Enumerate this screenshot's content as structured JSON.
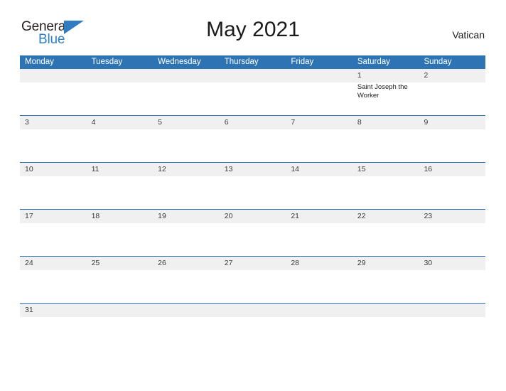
{
  "brand": {
    "name_part1": "General",
    "name_part2": "Blue",
    "triangle_color": "#2f7dc0",
    "text_color": "#231f20"
  },
  "header": {
    "title": "May 2021",
    "region": "Vatican"
  },
  "theme": {
    "header_blue": "#2e74b5",
    "date_band_gray": "#f0f0f0",
    "body_white": "#ffffff",
    "text_dark": "#3b3b3b"
  },
  "calendar": {
    "weekday_headers": [
      "Monday",
      "Tuesday",
      "Wednesday",
      "Thursday",
      "Friday",
      "Saturday",
      "Sunday"
    ],
    "weeks": [
      {
        "days": [
          {
            "num": "",
            "event": ""
          },
          {
            "num": "",
            "event": ""
          },
          {
            "num": "",
            "event": ""
          },
          {
            "num": "",
            "event": ""
          },
          {
            "num": "",
            "event": ""
          },
          {
            "num": "1",
            "event": "Saint Joseph the Worker"
          },
          {
            "num": "2",
            "event": ""
          }
        ]
      },
      {
        "days": [
          {
            "num": "3",
            "event": ""
          },
          {
            "num": "4",
            "event": ""
          },
          {
            "num": "5",
            "event": ""
          },
          {
            "num": "6",
            "event": ""
          },
          {
            "num": "7",
            "event": ""
          },
          {
            "num": "8",
            "event": ""
          },
          {
            "num": "9",
            "event": ""
          }
        ]
      },
      {
        "days": [
          {
            "num": "10",
            "event": ""
          },
          {
            "num": "11",
            "event": ""
          },
          {
            "num": "12",
            "event": ""
          },
          {
            "num": "13",
            "event": ""
          },
          {
            "num": "14",
            "event": ""
          },
          {
            "num": "15",
            "event": ""
          },
          {
            "num": "16",
            "event": ""
          }
        ]
      },
      {
        "days": [
          {
            "num": "17",
            "event": ""
          },
          {
            "num": "18",
            "event": ""
          },
          {
            "num": "19",
            "event": ""
          },
          {
            "num": "20",
            "event": ""
          },
          {
            "num": "21",
            "event": ""
          },
          {
            "num": "22",
            "event": ""
          },
          {
            "num": "23",
            "event": ""
          }
        ]
      },
      {
        "days": [
          {
            "num": "24",
            "event": ""
          },
          {
            "num": "25",
            "event": ""
          },
          {
            "num": "26",
            "event": ""
          },
          {
            "num": "27",
            "event": ""
          },
          {
            "num": "28",
            "event": ""
          },
          {
            "num": "29",
            "event": ""
          },
          {
            "num": "30",
            "event": ""
          }
        ]
      },
      {
        "last": true,
        "days": [
          {
            "num": "31",
            "event": ""
          },
          {
            "num": "",
            "event": ""
          },
          {
            "num": "",
            "event": ""
          },
          {
            "num": "",
            "event": ""
          },
          {
            "num": "",
            "event": ""
          },
          {
            "num": "",
            "event": ""
          },
          {
            "num": "",
            "event": ""
          }
        ]
      }
    ]
  }
}
